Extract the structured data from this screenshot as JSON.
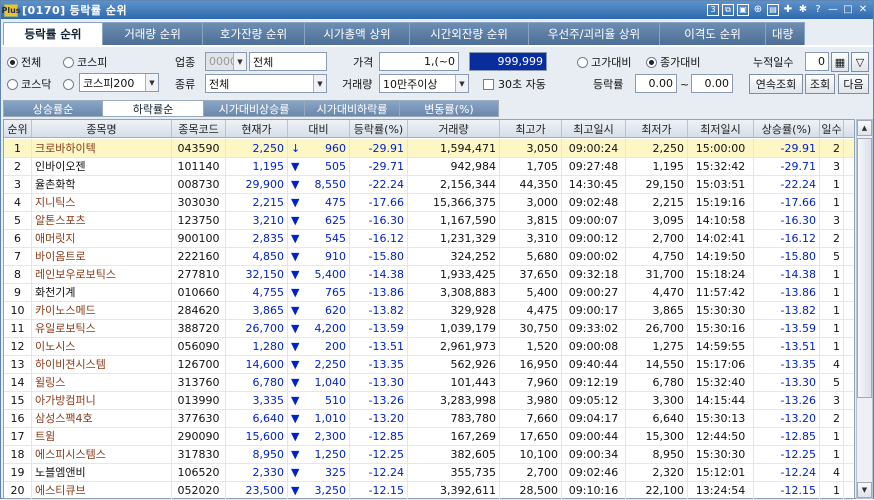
{
  "window": {
    "code": "[0170]",
    "title": "등락률 순위",
    "page_num": "3",
    "logo": "Plus"
  },
  "tabs": [
    "등락률 순위",
    "거래량 순위",
    "호가잔량 순위",
    "시가총액 상위",
    "시간외잔량 순위",
    "우선주/괴리율 상위",
    "이격도 순위",
    "대량"
  ],
  "filters": {
    "market": [
      "전체",
      "코스피",
      "코스닥",
      "코스피200"
    ],
    "market_selected": "전체",
    "kospi200_select": "코스피200",
    "sector_label": "업종",
    "sector_code": "0000",
    "sector_name": "전체",
    "type_label": "종류",
    "type_value": "전체",
    "price_label": "가격",
    "price_from": "1,(~0",
    "price_to": "999,999",
    "volume_label": "거래량",
    "volume_value": "10만주이상",
    "auto_label": "30초 자동",
    "compare": [
      "고가대비",
      "종가대비"
    ],
    "compare_selected": "종가대비",
    "rate_label": "등락률",
    "rate_from": "0.00",
    "rate_sep": "~",
    "rate_to": "0.00",
    "days_label": "누적일수",
    "days_value": "0",
    "btn_continuous": "연속조회",
    "btn_query": "조회",
    "btn_next": "다음"
  },
  "subtabs": [
    "상승률순",
    "하락률순",
    "시가대비상승률",
    "시가대비하락률",
    "변동률(%)"
  ],
  "columns": [
    "순위",
    "종목명",
    "종목코드",
    "현재가",
    "대비",
    "등락률(%)",
    "거래량",
    "최고가",
    "최고일시",
    "최저가",
    "최저일시",
    "상승률(%)",
    "일수"
  ],
  "rows": [
    [
      "1",
      "크로바하이텍",
      "043590",
      "2,250",
      "↓",
      "960",
      "-29.91",
      "1,594,471",
      "3,050",
      "09:00:24",
      "2,250",
      "15:00:00",
      "-29.91",
      "2"
    ],
    [
      "2",
      "인바이오젠",
      "101140",
      "1,195",
      "▼",
      "505",
      "-29.71",
      "942,984",
      "1,705",
      "09:27:48",
      "1,195",
      "15:32:42",
      "-29.71",
      "3"
    ],
    [
      "3",
      "율촌화학",
      "008730",
      "29,900",
      "▼",
      "8,550",
      "-22.24",
      "2,156,344",
      "44,350",
      "14:30:45",
      "29,150",
      "15:03:51",
      "-22.24",
      "1"
    ],
    [
      "4",
      "지니틱스",
      "303030",
      "2,215",
      "▼",
      "475",
      "-17.66",
      "15,366,375",
      "3,000",
      "09:02:48",
      "2,215",
      "15:19:16",
      "-17.66",
      "1"
    ],
    [
      "5",
      "알톤스포츠",
      "123750",
      "3,210",
      "▼",
      "625",
      "-16.30",
      "1,167,590",
      "3,815",
      "09:00:07",
      "3,095",
      "14:10:58",
      "-16.30",
      "3"
    ],
    [
      "6",
      "애머릿지",
      "900100",
      "2,835",
      "▼",
      "545",
      "-16.12",
      "1,231,329",
      "3,310",
      "09:00:12",
      "2,700",
      "14:02:41",
      "-16.12",
      "2"
    ],
    [
      "7",
      "바이옴트로",
      "222160",
      "4,850",
      "▼",
      "910",
      "-15.80",
      "324,252",
      "5,680",
      "09:00:02",
      "4,750",
      "14:19:50",
      "-15.80",
      "5"
    ],
    [
      "8",
      "레인보우로보틱스",
      "277810",
      "32,150",
      "▼",
      "5,400",
      "-14.38",
      "1,933,425",
      "37,650",
      "09:32:18",
      "31,700",
      "15:18:24",
      "-14.38",
      "1"
    ],
    [
      "9",
      "화천기계",
      "010660",
      "4,755",
      "▼",
      "765",
      "-13.86",
      "3,308,883",
      "5,400",
      "09:00:27",
      "4,470",
      "11:57:42",
      "-13.86",
      "1"
    ],
    [
      "10",
      "카이노스메드",
      "284620",
      "3,865",
      "▼",
      "620",
      "-13.82",
      "329,928",
      "4,475",
      "09:00:17",
      "3,865",
      "15:30:30",
      "-13.82",
      "1"
    ],
    [
      "11",
      "유일로보틱스",
      "388720",
      "26,700",
      "▼",
      "4,200",
      "-13.59",
      "1,039,179",
      "30,750",
      "09:33:02",
      "26,700",
      "15:30:16",
      "-13.59",
      "1"
    ],
    [
      "12",
      "이노시스",
      "056090",
      "1,280",
      "▼",
      "200",
      "-13.51",
      "2,961,973",
      "1,520",
      "09:00:08",
      "1,275",
      "14:59:55",
      "-13.51",
      "1"
    ],
    [
      "13",
      "하이비젼시스템",
      "126700",
      "14,600",
      "▼",
      "2,250",
      "-13.35",
      "562,926",
      "16,950",
      "09:40:44",
      "14,550",
      "15:17:06",
      "-13.35",
      "4"
    ],
    [
      "14",
      "윌링스",
      "313760",
      "6,780",
      "▼",
      "1,040",
      "-13.30",
      "101,443",
      "7,960",
      "09:12:19",
      "6,780",
      "15:32:40",
      "-13.30",
      "5"
    ],
    [
      "15",
      "아가방컴퍼니",
      "013990",
      "3,335",
      "▼",
      "510",
      "-13.26",
      "3,283,998",
      "3,980",
      "09:05:12",
      "3,300",
      "14:15:44",
      "-13.26",
      "3"
    ],
    [
      "16",
      "삼성스팩4호",
      "377630",
      "6,640",
      "▼",
      "1,010",
      "-13.20",
      "783,780",
      "7,660",
      "09:04:17",
      "6,640",
      "15:30:13",
      "-13.20",
      "2"
    ],
    [
      "17",
      "트윔",
      "290090",
      "15,600",
      "▼",
      "2,300",
      "-12.85",
      "167,269",
      "17,650",
      "09:00:44",
      "15,300",
      "12:44:50",
      "-12.85",
      "1"
    ],
    [
      "18",
      "에스피시스템스",
      "317830",
      "8,950",
      "▼",
      "1,250",
      "-12.25",
      "382,605",
      "10,100",
      "09:00:34",
      "8,950",
      "15:30:30",
      "-12.25",
      "1"
    ],
    [
      "19",
      "노블엠앤비",
      "106520",
      "2,330",
      "▼",
      "325",
      "-12.24",
      "355,735",
      "2,700",
      "09:02:46",
      "2,320",
      "15:12:01",
      "-12.24",
      "4"
    ],
    [
      "20",
      "에스티큐브",
      "052020",
      "23,500",
      "▼",
      "3,250",
      "-12.15",
      "3,392,611",
      "28,500",
      "09:10:16",
      "22,100",
      "13:24:54",
      "-12.15",
      "1"
    ]
  ],
  "black_names": [
    "인바이오젠",
    "율촌화학",
    "화천기계",
    "노블엠앤비"
  ],
  "colors": {
    "title_bar": "#3d77b8",
    "down": "#0022cc",
    "selected_row": "#fdf6c5",
    "name": "#8a3a1a"
  }
}
